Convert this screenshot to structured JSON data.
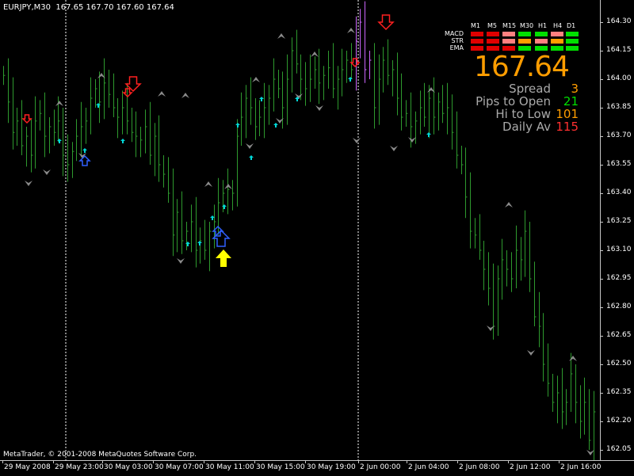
{
  "window": {
    "symbol_label": "EURJPY,M30  167.65 167.70 167.60 167.64",
    "copyright": "MetaTrader, © 2001-2008 MetaQuotes Software Corp."
  },
  "price_axis": {
    "labels": [
      "164.30",
      "164.15",
      "164.00",
      "163.85",
      "163.70",
      "163.55",
      "163.40",
      "163.25",
      "163.10",
      "162.95",
      "162.80",
      "162.65",
      "162.50",
      "162.35",
      "162.20",
      "162.05"
    ]
  },
  "time_axis": {
    "labels": [
      "29 May 2008",
      "29 May 23:00",
      "30 May 03:00",
      "30 May 07:00",
      "30 May 11:00",
      "30 May 15:00",
      "30 May 19:00",
      "2 Jun 00:00",
      "2 Jun 04:00",
      "2 Jun 08:00",
      "2 Jun 12:00",
      "2 Jun 16:00"
    ]
  },
  "signal_panel": {
    "timeframes": [
      "M1",
      "M5",
      "M15",
      "M30",
      "H1",
      "H4",
      "D1"
    ],
    "rows": [
      {
        "label": "MACD",
        "colors": [
          "#e00000",
          "#e00000",
          "#ff8080",
          "#00e000",
          "#00e000",
          "#ff8080",
          "#00e000"
        ]
      },
      {
        "label": "STR",
        "colors": [
          "#e00000",
          "#e00000",
          "#ff8080",
          "#ff9d00",
          "#ff8080",
          "#ff9d00",
          "#00e000"
        ]
      },
      {
        "label": "EMA",
        "colors": [
          "#e00000",
          "#e00000",
          "#e00000",
          "#00e000",
          "#00e000",
          "#00e000",
          "#00e000"
        ]
      }
    ]
  },
  "info": {
    "price": "167.64",
    "rows": [
      {
        "label": "Spread",
        "value": "3",
        "label_color": "#aaaaaa",
        "value_color": "#ff9d00"
      },
      {
        "label": "Pips to Open",
        "value": "21",
        "label_color": "#aaaaaa",
        "value_color": "#00e000"
      },
      {
        "label": "Hi to Low",
        "value": "101",
        "label_color": "#aaaaaa",
        "value_color": "#ff9d00"
      },
      {
        "label": "Daily Av",
        "value": "115",
        "label_color": "#aaaaaa",
        "value_color": "#ff3030"
      }
    ]
  },
  "colors": {
    "bar": "#2e9a2e",
    "bar_highlight": "#cc66ff",
    "grid_separator": "#ffffff",
    "arrow_up_cyan": "#00d8d8",
    "arrow_up_blue": "#3060ff",
    "arrow_down_red": "#ff2020",
    "arrow_signal": "#ffff00",
    "fractal": "#8a8a8a"
  },
  "chart_data": {
    "type": "ohlc",
    "symbol": "EURJPY",
    "timeframe": "M30",
    "ylim": [
      162.0,
      164.38
    ],
    "bars_close": [
      164.02,
      163.88,
      163.72,
      163.78,
      163.65,
      163.7,
      163.6,
      163.78,
      163.82,
      163.7,
      163.75,
      163.72,
      163.78,
      163.6,
      163.55,
      163.62,
      163.7,
      163.75,
      163.78,
      163.9,
      163.95,
      163.88,
      163.98,
      163.92,
      163.85,
      163.8,
      163.85,
      163.78,
      163.72,
      163.7,
      163.68,
      163.75,
      163.6,
      163.7,
      163.55,
      163.5,
      163.4,
      163.18,
      163.3,
      163.15,
      163.2,
      163.25,
      163.1,
      163.15,
      163.1,
      163.2,
      163.25,
      163.35,
      163.4,
      163.42,
      163.4,
      163.7,
      163.8,
      163.9,
      163.85,
      163.75,
      163.8,
      163.85,
      163.9,
      164.0,
      163.95,
      163.85,
      164.0,
      164.15,
      164.08,
      164.0,
      163.95,
      164.0,
      164.05,
      163.98,
      164.02,
      164.06,
      163.95,
      164.0,
      164.05,
      164.1,
      164.05,
      164.2,
      164.3,
      164.05,
      164.1,
      163.85,
      164.0,
      164.1,
      164.02,
      164.05,
      163.9,
      163.8,
      163.82,
      163.75,
      163.78,
      163.85,
      163.8,
      163.9,
      163.8,
      163.88,
      163.82,
      163.85,
      163.72,
      163.6,
      163.55,
      163.38,
      163.2,
      163.18,
      163.1,
      163.0,
      162.9,
      162.7,
      162.95,
      163.05,
      163.0,
      162.95,
      163.1,
      163.05,
      163.2,
      162.95,
      162.75,
      162.7,
      162.5,
      162.4,
      162.3,
      162.35,
      162.25,
      162.3,
      162.45,
      162.3,
      162.2,
      162.3,
      162.1,
      162.25
    ]
  }
}
